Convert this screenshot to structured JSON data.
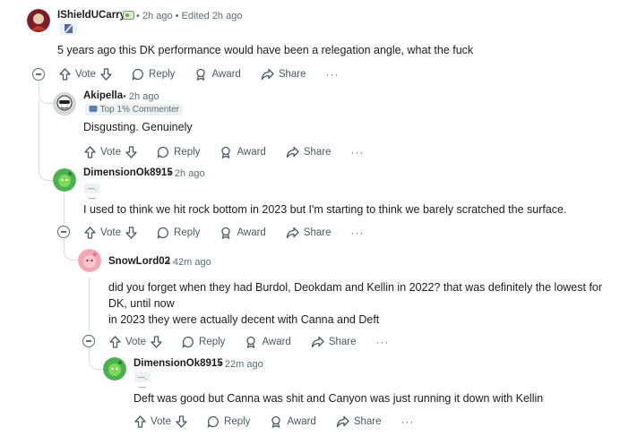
{
  "comments": [
    {
      "user": "IShieldUCarry",
      "time": "2h ago",
      "edited": "Edited 2h ago",
      "body": "5 years ago this DK performance would have been a relegation angle, what the fuck"
    },
    {
      "user": "Akipella",
      "time": "2h ago",
      "flair": "Top 1% Commenter",
      "body": "Disgusting. Genuinely"
    },
    {
      "user": "DimensionOk8915",
      "time": "2h ago",
      "flair": "—.—",
      "body": "I used to think we hit rock bottom in 2023 but I'm starting to think we barely scratched the surface."
    },
    {
      "user": "SnowLord02",
      "time": "42m ago",
      "body1": "did you forget when they had Burdol, Deokdam and Kellin in 2022? that was definitely the lowest for",
      "body2": "DK, until now",
      "body3": "in 2023 they were actually decent with Canna and Deft"
    },
    {
      "user": "DimensionOk8915",
      "time": "22m ago",
      "flair": "—.—",
      "body": "Deft was good but Canna was shit and Canyon was just running it down with Kellin"
    }
  ],
  "actions": {
    "vote": "Vote",
    "reply": "Reply",
    "award": "Award",
    "share": "Share",
    "more": "···"
  },
  "sep": "•",
  "icons": [
    "upvote-icon",
    "downvote-icon",
    "reply-bubble-icon",
    "award-icon",
    "share-arrow-icon",
    "collapse-icon",
    "more-icon"
  ]
}
